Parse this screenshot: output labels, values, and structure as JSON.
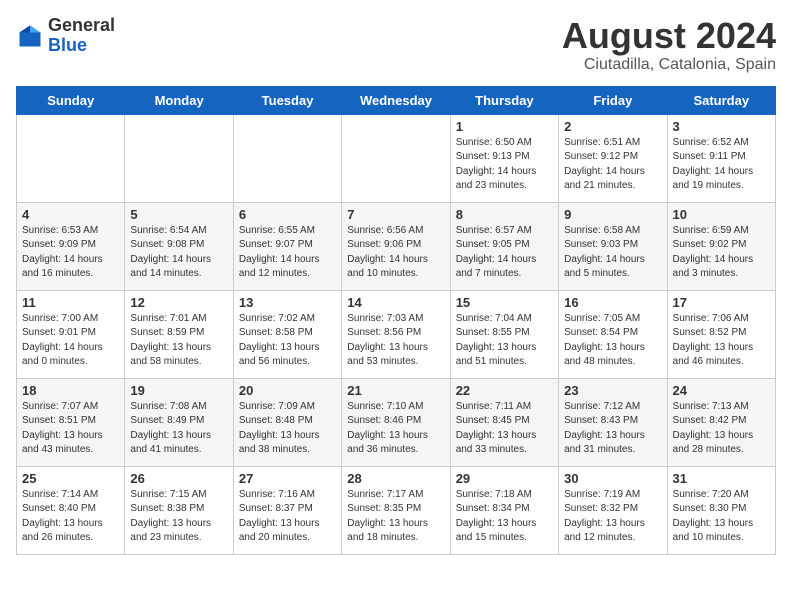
{
  "header": {
    "logo_general": "General",
    "logo_blue": "Blue",
    "title": "August 2024",
    "subtitle": "Ciutadilla, Catalonia, Spain"
  },
  "calendar": {
    "days_of_week": [
      "Sunday",
      "Monday",
      "Tuesday",
      "Wednesday",
      "Thursday",
      "Friday",
      "Saturday"
    ],
    "weeks": [
      [
        {
          "day": "",
          "info": ""
        },
        {
          "day": "",
          "info": ""
        },
        {
          "day": "",
          "info": ""
        },
        {
          "day": "",
          "info": ""
        },
        {
          "day": "1",
          "info": "Sunrise: 6:50 AM\nSunset: 9:13 PM\nDaylight: 14 hours\nand 23 minutes."
        },
        {
          "day": "2",
          "info": "Sunrise: 6:51 AM\nSunset: 9:12 PM\nDaylight: 14 hours\nand 21 minutes."
        },
        {
          "day": "3",
          "info": "Sunrise: 6:52 AM\nSunset: 9:11 PM\nDaylight: 14 hours\nand 19 minutes."
        }
      ],
      [
        {
          "day": "4",
          "info": "Sunrise: 6:53 AM\nSunset: 9:09 PM\nDaylight: 14 hours\nand 16 minutes."
        },
        {
          "day": "5",
          "info": "Sunrise: 6:54 AM\nSunset: 9:08 PM\nDaylight: 14 hours\nand 14 minutes."
        },
        {
          "day": "6",
          "info": "Sunrise: 6:55 AM\nSunset: 9:07 PM\nDaylight: 14 hours\nand 12 minutes."
        },
        {
          "day": "7",
          "info": "Sunrise: 6:56 AM\nSunset: 9:06 PM\nDaylight: 14 hours\nand 10 minutes."
        },
        {
          "day": "8",
          "info": "Sunrise: 6:57 AM\nSunset: 9:05 PM\nDaylight: 14 hours\nand 7 minutes."
        },
        {
          "day": "9",
          "info": "Sunrise: 6:58 AM\nSunset: 9:03 PM\nDaylight: 14 hours\nand 5 minutes."
        },
        {
          "day": "10",
          "info": "Sunrise: 6:59 AM\nSunset: 9:02 PM\nDaylight: 14 hours\nand 3 minutes."
        }
      ],
      [
        {
          "day": "11",
          "info": "Sunrise: 7:00 AM\nSunset: 9:01 PM\nDaylight: 14 hours\nand 0 minutes."
        },
        {
          "day": "12",
          "info": "Sunrise: 7:01 AM\nSunset: 8:59 PM\nDaylight: 13 hours\nand 58 minutes."
        },
        {
          "day": "13",
          "info": "Sunrise: 7:02 AM\nSunset: 8:58 PM\nDaylight: 13 hours\nand 56 minutes."
        },
        {
          "day": "14",
          "info": "Sunrise: 7:03 AM\nSunset: 8:56 PM\nDaylight: 13 hours\nand 53 minutes."
        },
        {
          "day": "15",
          "info": "Sunrise: 7:04 AM\nSunset: 8:55 PM\nDaylight: 13 hours\nand 51 minutes."
        },
        {
          "day": "16",
          "info": "Sunrise: 7:05 AM\nSunset: 8:54 PM\nDaylight: 13 hours\nand 48 minutes."
        },
        {
          "day": "17",
          "info": "Sunrise: 7:06 AM\nSunset: 8:52 PM\nDaylight: 13 hours\nand 46 minutes."
        }
      ],
      [
        {
          "day": "18",
          "info": "Sunrise: 7:07 AM\nSunset: 8:51 PM\nDaylight: 13 hours\nand 43 minutes."
        },
        {
          "day": "19",
          "info": "Sunrise: 7:08 AM\nSunset: 8:49 PM\nDaylight: 13 hours\nand 41 minutes."
        },
        {
          "day": "20",
          "info": "Sunrise: 7:09 AM\nSunset: 8:48 PM\nDaylight: 13 hours\nand 38 minutes."
        },
        {
          "day": "21",
          "info": "Sunrise: 7:10 AM\nSunset: 8:46 PM\nDaylight: 13 hours\nand 36 minutes."
        },
        {
          "day": "22",
          "info": "Sunrise: 7:11 AM\nSunset: 8:45 PM\nDaylight: 13 hours\nand 33 minutes."
        },
        {
          "day": "23",
          "info": "Sunrise: 7:12 AM\nSunset: 8:43 PM\nDaylight: 13 hours\nand 31 minutes."
        },
        {
          "day": "24",
          "info": "Sunrise: 7:13 AM\nSunset: 8:42 PM\nDaylight: 13 hours\nand 28 minutes."
        }
      ],
      [
        {
          "day": "25",
          "info": "Sunrise: 7:14 AM\nSunset: 8:40 PM\nDaylight: 13 hours\nand 26 minutes."
        },
        {
          "day": "26",
          "info": "Sunrise: 7:15 AM\nSunset: 8:38 PM\nDaylight: 13 hours\nand 23 minutes."
        },
        {
          "day": "27",
          "info": "Sunrise: 7:16 AM\nSunset: 8:37 PM\nDaylight: 13 hours\nand 20 minutes."
        },
        {
          "day": "28",
          "info": "Sunrise: 7:17 AM\nSunset: 8:35 PM\nDaylight: 13 hours\nand 18 minutes."
        },
        {
          "day": "29",
          "info": "Sunrise: 7:18 AM\nSunset: 8:34 PM\nDaylight: 13 hours\nand 15 minutes."
        },
        {
          "day": "30",
          "info": "Sunrise: 7:19 AM\nSunset: 8:32 PM\nDaylight: 13 hours\nand 12 minutes."
        },
        {
          "day": "31",
          "info": "Sunrise: 7:20 AM\nSunset: 8:30 PM\nDaylight: 13 hours\nand 10 minutes."
        }
      ]
    ]
  }
}
